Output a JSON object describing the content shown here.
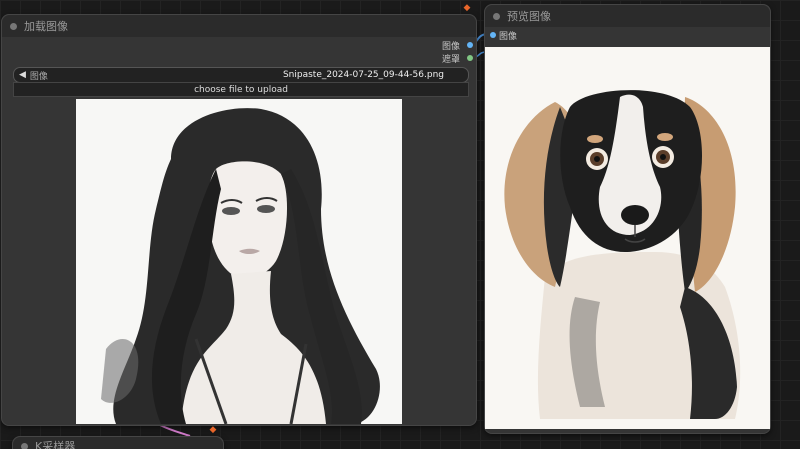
{
  "load_node": {
    "title": "加载图像",
    "outputs": [
      "图像",
      "遮罩"
    ],
    "widget_name": "图像",
    "file_value": "Snipaste_2024-07-25_09-44-56.png",
    "upload_label": "choose file to upload"
  },
  "preview_node": {
    "title": "预览图像",
    "input_label": "图像"
  },
  "sampler_node": {
    "title": "K采样器"
  },
  "colors": {
    "image_slot": "#64b5f6",
    "mask_slot": "#81c784",
    "link_blue": "#4a90d9",
    "link_pink": "#d77fd0"
  },
  "icons": {
    "badge": "fox-icon"
  }
}
